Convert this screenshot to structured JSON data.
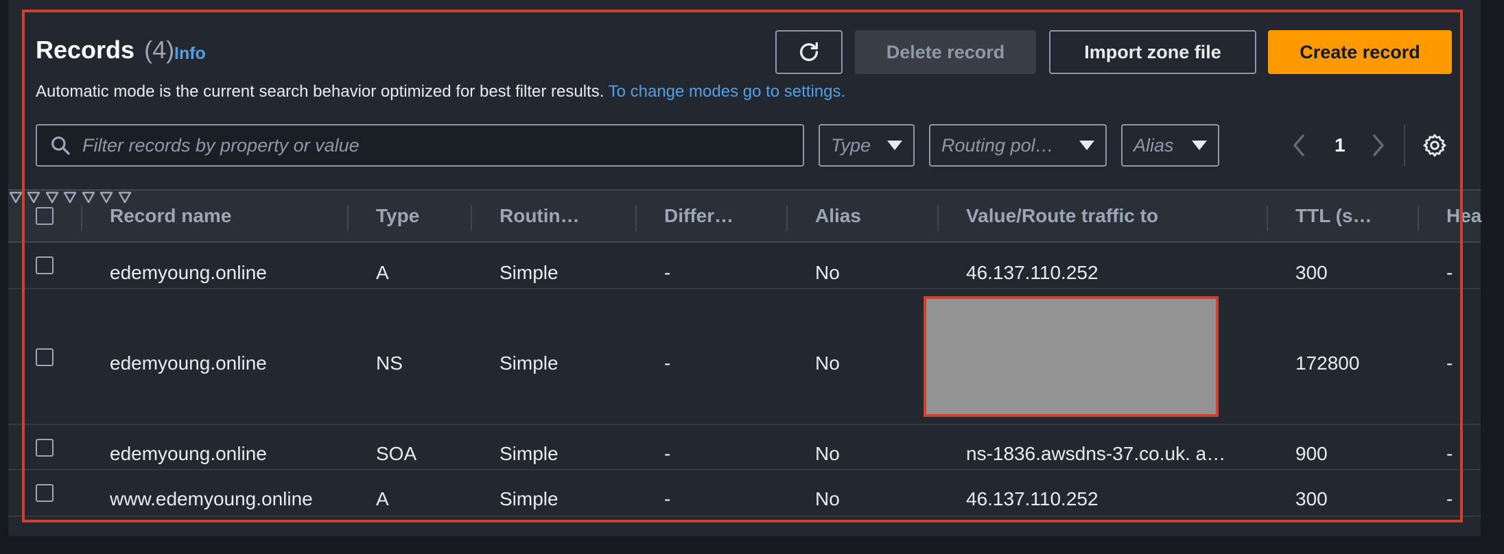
{
  "header": {
    "title": "Records",
    "count": "(4)",
    "info_link": "Info",
    "description": "Automatic mode is the current search behavior optimized for best filter results.",
    "description_link": "To change modes go to settings."
  },
  "toolbar": {
    "refresh_icon": "refresh-icon",
    "delete_label": "Delete record",
    "import_label": "Import zone file",
    "create_label": "Create record"
  },
  "filters": {
    "search_placeholder": "Filter records by property or value",
    "type_label": "Type",
    "routing_label": "Routing pol…",
    "alias_label": "Alias"
  },
  "pagination": {
    "current_page": "1"
  },
  "table": {
    "columns": [
      "Record name",
      "Type",
      "Routin…",
      "Differ…",
      "Alias",
      "Value/Route traffic to",
      "TTL (s…",
      "Hea"
    ],
    "rows": [
      {
        "name": "edemyoung.online",
        "type": "A",
        "routing": "Simple",
        "differ": "-",
        "alias": "No",
        "value": "46.137.110.252",
        "ttl": "300",
        "health": "-"
      },
      {
        "name": "edemyoung.online",
        "type": "NS",
        "routing": "Simple",
        "differ": "-",
        "alias": "No",
        "value": "",
        "ttl": "172800",
        "health": "-"
      },
      {
        "name": "edemyoung.online",
        "type": "SOA",
        "routing": "Simple",
        "differ": "-",
        "alias": "No",
        "value": "ns-1836.awsdns-37.co.uk. a…",
        "ttl": "900",
        "health": "-"
      },
      {
        "name": "www.edemyoung.online",
        "type": "A",
        "routing": "Simple",
        "differ": "-",
        "alias": "No",
        "value": "46.137.110.252",
        "ttl": "300",
        "health": "-"
      }
    ]
  },
  "colors": {
    "accent": "#ff9900",
    "link": "#539fe5",
    "highlight": "#d0402b",
    "redaction": "#939393"
  }
}
